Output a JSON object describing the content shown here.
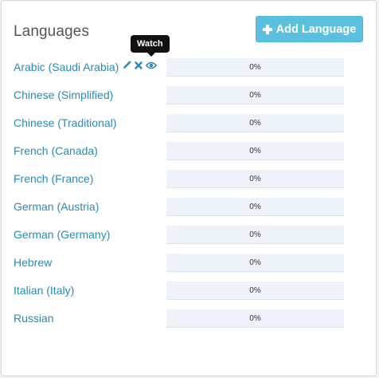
{
  "panel": {
    "title": "Languages",
    "add_button_label": "Add Language",
    "tooltip": "Watch"
  },
  "languages": [
    {
      "name": "Arabic (Saudi Arabia)",
      "progress": "0%",
      "progress_value": 0
    },
    {
      "name": "Chinese (Simplified)",
      "progress": "0%",
      "progress_value": 0
    },
    {
      "name": "Chinese (Traditional)",
      "progress": "0%",
      "progress_value": 0
    },
    {
      "name": "French (Canada)",
      "progress": "0%",
      "progress_value": 0
    },
    {
      "name": "French (France)",
      "progress": "0%",
      "progress_value": 0
    },
    {
      "name": "German (Austria)",
      "progress": "0%",
      "progress_value": 0
    },
    {
      "name": "German (Germany)",
      "progress": "0%",
      "progress_value": 0
    },
    {
      "name": "Hebrew",
      "progress": "0%",
      "progress_value": 0
    },
    {
      "name": "Italian (Italy)",
      "progress": "0%",
      "progress_value": 0
    },
    {
      "name": "Russian",
      "progress": "0%",
      "progress_value": 0
    }
  ],
  "row_icons": [
    "pencil-icon",
    "close-icon",
    "eye-icon"
  ],
  "colors": {
    "accent": "#5bc0de",
    "link": "#2a8ab8",
    "progress_track": "#eef3fa"
  }
}
